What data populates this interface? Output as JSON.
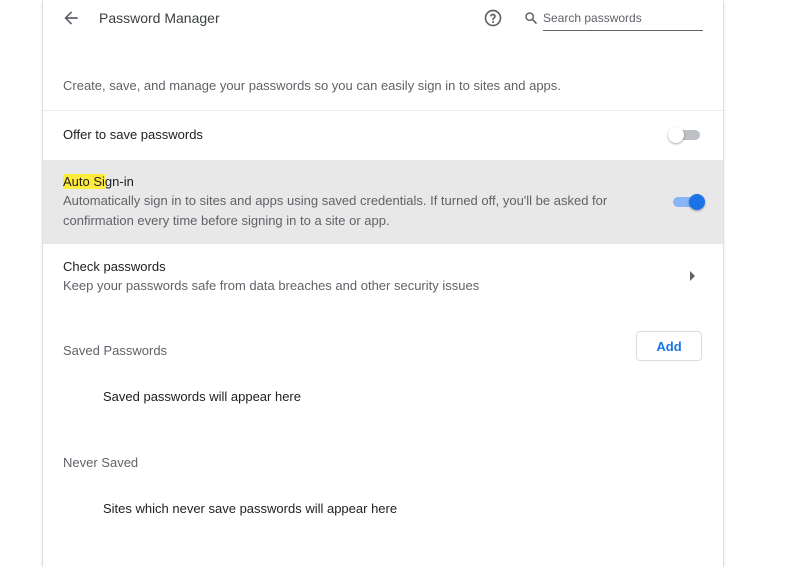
{
  "header": {
    "title": "Password Manager",
    "back_icon": "arrow-back-icon",
    "help_icon": "help-circle-icon",
    "search": {
      "icon": "search-icon",
      "placeholder": "Search passwords",
      "value": ""
    }
  },
  "intro": "Create, save, and manage your passwords so you can easily sign in to sites and apps.",
  "offer_to_save": {
    "label": "Offer to save passwords",
    "enabled": false
  },
  "auto_signin": {
    "label_highlighted": "Auto Si",
    "label_rest": "gn-in",
    "description": "Automatically sign in to sites and apps using saved credentials. If turned off, you'll be asked for confirmation every time before signing in to a site or app.",
    "enabled": true
  },
  "check_passwords": {
    "label": "Check passwords",
    "description": "Keep your passwords safe from data breaches and other security issues"
  },
  "saved_passwords": {
    "title": "Saved Passwords",
    "add_label": "Add",
    "empty": "Saved passwords will appear here"
  },
  "never_saved": {
    "title": "Never Saved",
    "empty": "Sites which never save passwords will appear here"
  },
  "colors": {
    "accent": "#1a73e8",
    "highlight": "#ffeb3b",
    "hover_row": "#e8e8e8"
  }
}
